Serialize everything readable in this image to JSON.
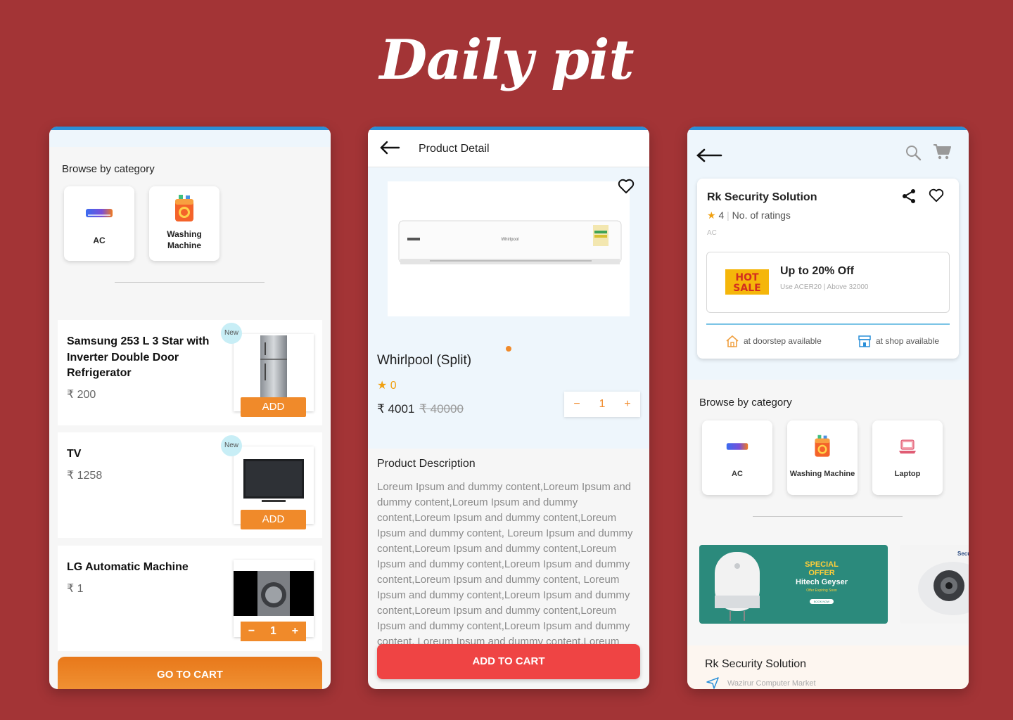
{
  "brand": "Daily pit",
  "screen1": {
    "section_title": "Browse by category",
    "categories": [
      {
        "label": "AC",
        "icon": "ac-icon"
      },
      {
        "label": "Washing Machine",
        "icon": "washing-machine-icon"
      }
    ],
    "products": [
      {
        "name": "Samsung 253 L 3 Star with Inverter Double Door Refrigerator",
        "price": "₹ 200",
        "badge": "New",
        "action": "ADD"
      },
      {
        "name": "TV",
        "price": "₹ 1258",
        "badge": "New",
        "action": "ADD"
      },
      {
        "name": "LG Automatic Machine",
        "price": "₹ 1",
        "quantity": "1"
      }
    ],
    "go_to_cart": "GO TO CART"
  },
  "screen2": {
    "header_title": "Product Detail",
    "product_name": "Whirlpool (Split)",
    "rating": "0",
    "price": "₹ 4001",
    "old_price": "₹ 40000",
    "quantity": "1",
    "image_brand": "Whirlpool",
    "description_title": "Product Description",
    "description": "Loreum Ipsum and dummy content,Loreum Ipsum and dummy content,Loreum Ipsum and dummy content,Loreum Ipsum and dummy content,Loreum Ipsum and dummy content, Loreum Ipsum and dummy content,Loreum Ipsum and dummy content,Loreum Ipsum and dummy content,Loreum Ipsum and dummy content,Loreum Ipsum and dummy content, Loreum Ipsum and dummy content,Loreum Ipsum and dummy content,Loreum Ipsum and dummy content,Loreum Ipsum and dummy content,Loreum Ipsum and dummy content, Loreum Ipsum and dummy content,Loreum Ipsum and dummy content,Loreum Ipsum and dummy",
    "add_to_cart": "ADD TO CART"
  },
  "screen3": {
    "store_name": "Rk Security Solution",
    "rating": "4",
    "ratings_label": "No. of ratings",
    "store_category": "AC",
    "offer_title": "Up to 20% Off",
    "offer_subtitle": "Use ACER20 | Above 32000",
    "offer_badge": "HOT SALE",
    "doorstep": "at doorstep available",
    "shop": "at shop available",
    "section_title": "Browse by category",
    "categories": [
      {
        "label": "AC",
        "icon": "ac-icon"
      },
      {
        "label": "Washing Machine",
        "icon": "washing-machine-icon"
      },
      {
        "label": "Laptop",
        "icon": "laptop-icon"
      }
    ],
    "banner": {
      "line1": "SPECIAL",
      "line2": "OFFER",
      "line3": "Hitech Geyser",
      "line4": "Offer Expiring Soon",
      "cta": "BOOK NOW"
    },
    "banner2_text": "Securi",
    "bottom_store": "Rk Security Solution",
    "bottom_address": "Wazirur Computer Market"
  },
  "colors": {
    "background": "#a33436",
    "accent_orange": "#f08a2a",
    "add_to_cart_red": "#ef4444",
    "top_bar_blue": "#2a8fd8"
  }
}
